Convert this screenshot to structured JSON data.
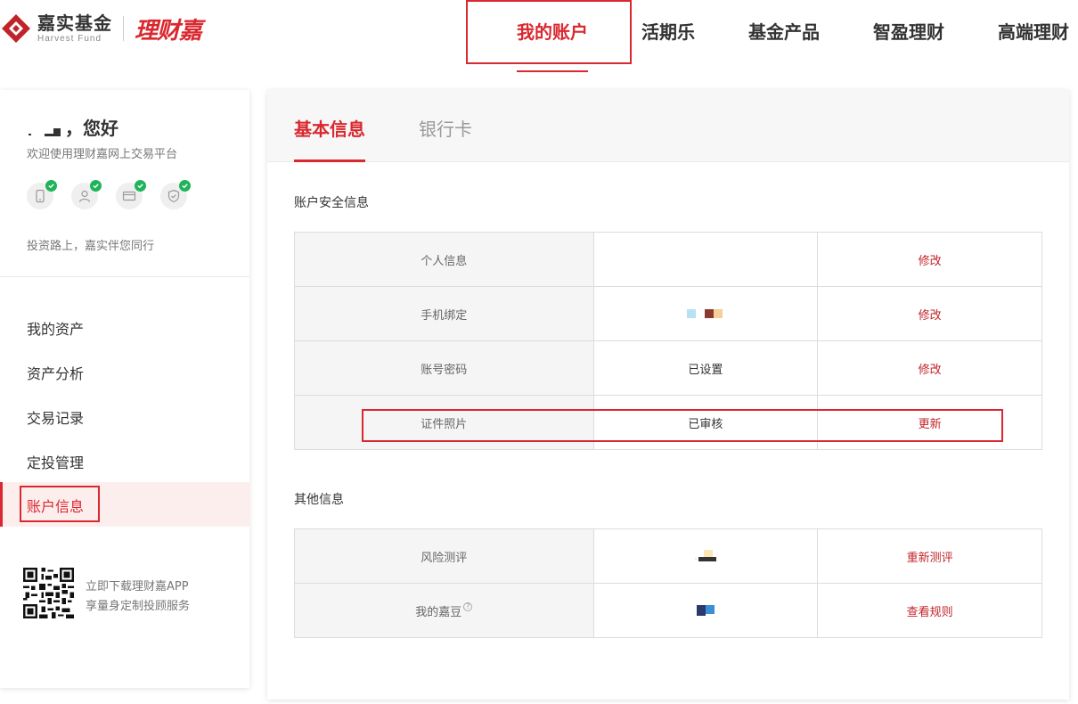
{
  "header": {
    "logo_cn": "嘉实基金",
    "logo_en": "Harvest Fund",
    "brand": "理财嘉",
    "nav": [
      {
        "label": "我的账户",
        "active": true
      },
      {
        "label": "活期乐",
        "active": false
      },
      {
        "label": "基金产品",
        "active": false
      },
      {
        "label": "智盈理财",
        "active": false
      },
      {
        "label": "高端理财",
        "active": false
      }
    ]
  },
  "sidebar": {
    "greeting_suffix": "，您好",
    "welcome": "欢迎使用理财嘉网上交易平台",
    "badges": [
      "phone-icon",
      "user-icon",
      "card-icon",
      "shield-icon"
    ],
    "motto": "投资路上，嘉实伴您同行",
    "menu": [
      {
        "label": "我的资产"
      },
      {
        "label": "资产分析"
      },
      {
        "label": "交易记录"
      },
      {
        "label": "定投管理"
      },
      {
        "label": "账户信息",
        "active": true
      }
    ],
    "app_line1": "立即下载理财嘉APP",
    "app_line2": "享量身定制投顾服务"
  },
  "main": {
    "tabs": [
      {
        "label": "基本信息",
        "active": true
      },
      {
        "label": "银行卡",
        "active": false
      }
    ],
    "security_title": "账户安全信息",
    "security_rows": [
      {
        "label": "个人信息",
        "value": "",
        "action": "修改"
      },
      {
        "label": "手机绑定",
        "value": "",
        "action": "修改"
      },
      {
        "label": "账号密码",
        "value": "已设置",
        "action": "修改"
      },
      {
        "label": "证件照片",
        "value": "已审核",
        "action": "更新"
      }
    ],
    "other_title": "其他信息",
    "other_rows": [
      {
        "label": "风险测评",
        "value": "",
        "action": "重新测评"
      },
      {
        "label": "我的嘉豆",
        "value": "",
        "action": "查看规则"
      }
    ]
  },
  "colors": {
    "accent": "#d9282f",
    "action_text": "#c0242a",
    "check_green": "#1fb35a"
  }
}
